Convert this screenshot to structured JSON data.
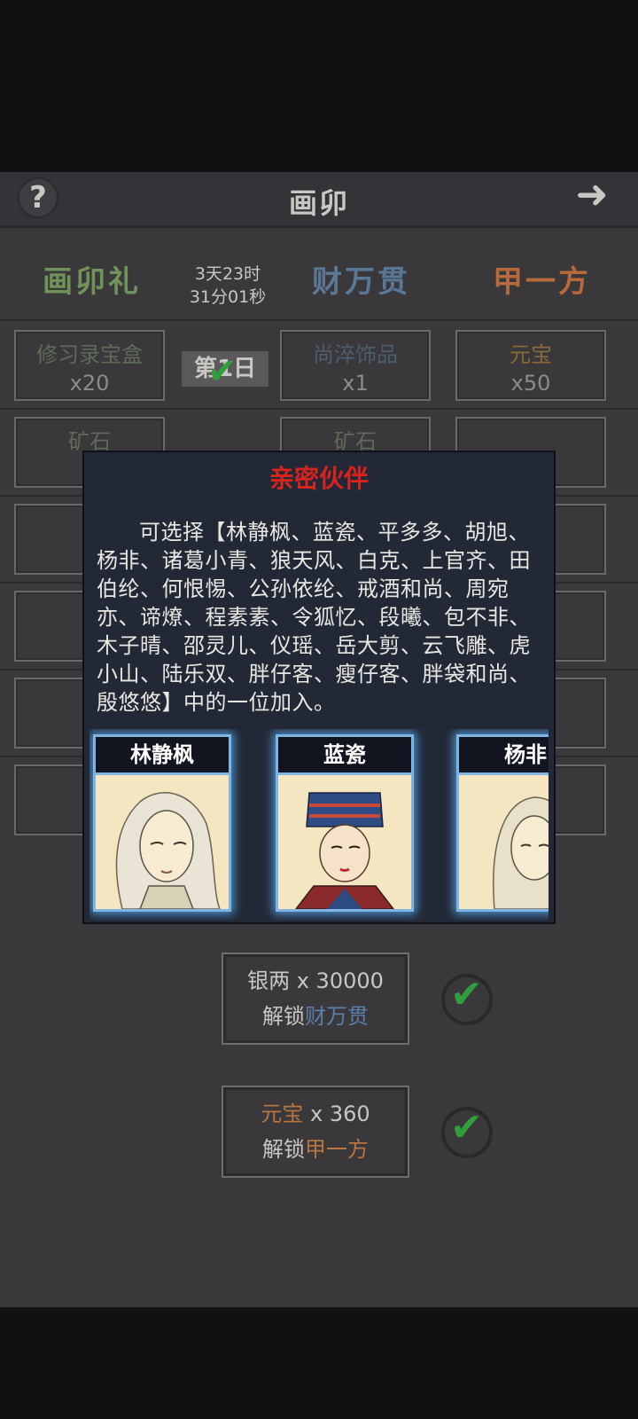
{
  "header": {
    "title": "画卯",
    "help_icon": "?",
    "next_icon": "➜"
  },
  "tiers": {
    "free": "画卯礼",
    "silver": "财万贯",
    "gold": "甲一方"
  },
  "timer": {
    "line1": "3天23时",
    "line2": "31分01秒"
  },
  "day_badge": "第1日",
  "rewards_row1": {
    "free": {
      "name": "修习录宝盒",
      "qty": "x20"
    },
    "silver": {
      "name": "尚淬饰品",
      "qty": "x1"
    },
    "gold": {
      "name": "元宝",
      "qty": "x50"
    }
  },
  "rewards_row2": {
    "free": "矿石",
    "silver": "矿石",
    "gold": ""
  },
  "modal": {
    "title": "亲密伙伴",
    "text1": "可选择【林静枫、蓝瓷、平多多、胡旭、杨非、诸葛小青、狼天风、白克、上官齐、田伯纶、何恨惕、公孙依纶、戒酒和尚、周宛亦、谛燎、程素素、令狐忆、段曦、包不非、木子晴、邵灵儿、仪瑶、岳大剪、云飞雕、虎小山、陆乐双、胖仔客、瘦仔客、胖袋和尚、殷悠悠】中的一位加入。",
    "cards": [
      {
        "name": "林静枫"
      },
      {
        "name": "蓝瓷"
      },
      {
        "name": "杨非"
      }
    ]
  },
  "unlock_silver": {
    "cost_label": "银两",
    "cost_value": "x 30000",
    "prefix": "解锁",
    "tier": "财万贯"
  },
  "unlock_gold": {
    "cost_label": "元宝",
    "cost_value": "x 360",
    "prefix": "解锁",
    "tier": "甲一方"
  },
  "colors": {
    "modal_title": "#d7231e",
    "free_tier": "#6f9358",
    "silver_tier": "#5a7896",
    "gold_tier": "#b76a3b",
    "check": "#2f9e3d",
    "card_glow": "#7fb4e3"
  }
}
